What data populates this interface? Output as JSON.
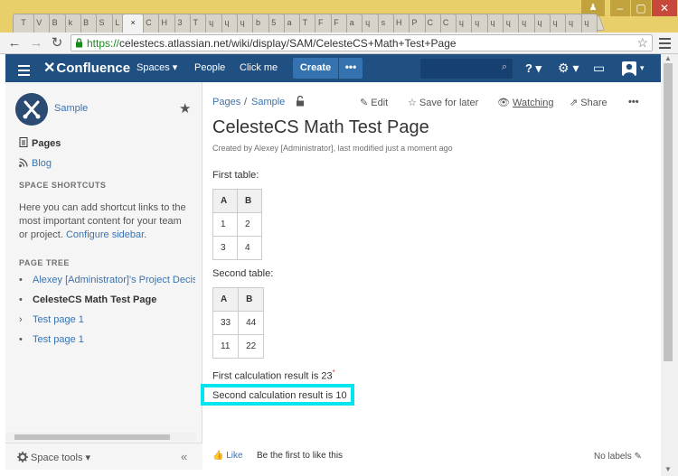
{
  "browser": {
    "tabs": [
      "T",
      "V",
      "B",
      "k",
      "B",
      "S",
      "L",
      "",
      "C",
      "H",
      "3",
      "T",
      "ɥ",
      "ɥ",
      "ɥ",
      "b",
      "5",
      "a",
      "T",
      "F",
      "F",
      "a",
      "ɥ",
      "s",
      "H",
      "P",
      "C",
      "C",
      "ɥ",
      "ɥ",
      "ɥ",
      "ɥ",
      "ɥ",
      "ɥ",
      "ɥ",
      "ɥ",
      "ɥ"
    ],
    "active_tab_index": 7,
    "active_tab_glyph": "×",
    "url_scheme": "https://",
    "url_rest": "celestecs.atlassian.net/wiki/display/SAM/CelesteCS+Math+Test+Page",
    "window_controls": {
      "user": "♟",
      "minimize": "–",
      "maximize": "▢",
      "close": "✕"
    },
    "nav": {
      "back": "←",
      "forward": "→",
      "reload": "↻",
      "star": "☆"
    }
  },
  "header": {
    "logo_x": "✕",
    "logo_text": "Confluence",
    "spaces": "Spaces ▾",
    "people": "People",
    "click_me": "Click me",
    "create": "Create",
    "more": "•••",
    "search_icon": "⌕",
    "help": "? ▾",
    "settings": "⚙ ▾",
    "notifications": "▭",
    "profile": "▾"
  },
  "sidebar": {
    "space_name": "Sample",
    "fav_icon": "★",
    "pages": "Pages",
    "blog": "Blog",
    "shortcuts_header": "SPACE SHORTCUTS",
    "shortcuts_text": "Here you can add shortcut links to the most important content for your team or project.",
    "configure_link": "Configure sidebar",
    "page_tree_header": "PAGE TREE",
    "tree": [
      {
        "bullet": "•",
        "label": "Alexey [Administrator]'s Project Decisio"
      },
      {
        "bullet": "•",
        "label": "CelesteCS Math Test Page"
      },
      {
        "bullet": "›",
        "label": "Test page 1"
      },
      {
        "bullet": "•",
        "label": "Test page 1"
      }
    ],
    "space_tools": "Space tools ▾",
    "collapse": "«"
  },
  "page": {
    "breadcrumb": [
      "Pages",
      "Sample"
    ],
    "breadcrumb_sep": "/",
    "restrictions_icon": "⌂",
    "actions": {
      "edit": "Edit",
      "save_for_later": "Save for later",
      "watching": "Watching",
      "share": "Share",
      "more": "•••"
    },
    "title": "CelesteCS Math Test Page",
    "byline_prefix": "Created by ",
    "author": "Alexey [Administrator]",
    "byline_mid": ", last modified ",
    "modified": "just a moment ago",
    "first_table_label": "First table:",
    "first_table": {
      "headers": [
        "A",
        "B"
      ],
      "rows": [
        [
          "1",
          "2"
        ],
        [
          "3",
          "4"
        ]
      ]
    },
    "second_table_label": "Second table:",
    "second_table": {
      "headers": [
        "A",
        "B"
      ],
      "rows": [
        [
          "33",
          "44"
        ],
        [
          "11",
          "22"
        ]
      ]
    },
    "calc1": "First calculation result is 23",
    "calc1_marker": "*",
    "calc2": "Second calculation result is 10",
    "like": "Like",
    "first_to_like": "Be the first to like this",
    "no_labels": "No labels"
  }
}
